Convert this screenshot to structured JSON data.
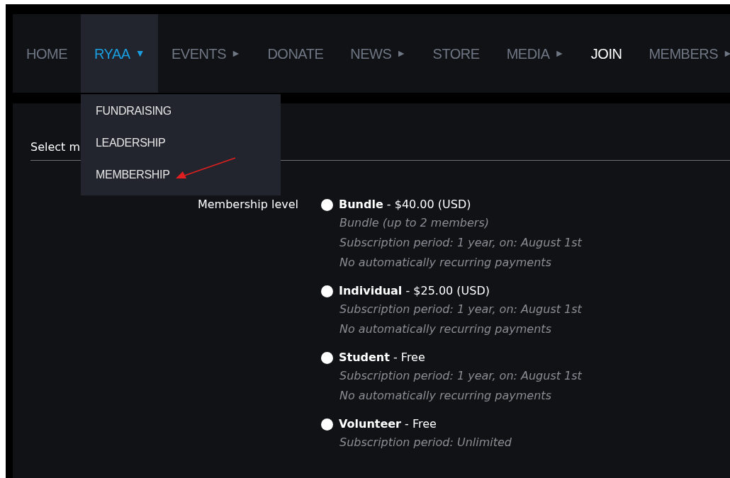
{
  "nav": [
    {
      "label": "HOME",
      "expanded": false,
      "selected": false
    },
    {
      "label": "RYAA",
      "caret": "▼",
      "expanded": true,
      "selected": false
    },
    {
      "label": "EVENTS",
      "caret": "►",
      "expanded": false,
      "selected": false
    },
    {
      "label": "DONATE",
      "expanded": false,
      "selected": false
    },
    {
      "label": "NEWS",
      "caret": "►",
      "expanded": false,
      "selected": false
    },
    {
      "label": "STORE",
      "expanded": false,
      "selected": false
    },
    {
      "label": "MEDIA",
      "caret": "►",
      "expanded": false,
      "selected": false
    },
    {
      "label": "JOIN",
      "expanded": false,
      "selected": true
    },
    {
      "label": "MEMBERS",
      "caret": "►",
      "expanded": false,
      "selected": false
    }
  ],
  "dropdown": {
    "items": [
      "FUNDRAISING",
      "LEADERSHIP",
      "MEMBERSHIP"
    ]
  },
  "form": {
    "heading": "Select m",
    "field_label": "Membership level",
    "options": [
      {
        "title": "**Bundle** - $40.00 (USD)",
        "selected": false,
        "details": [
          "Bundle (up to 2 members)",
          "Subscription period: 1 year, on: August 1st",
          "No automatically recurring payments"
        ]
      },
      {
        "title": "**Individual** - $25.00 (USD)",
        "selected": false,
        "details": [
          "Subscription period: 1 year, on: August 1st",
          "No automatically recurring payments"
        ]
      },
      {
        "title": "**Student** - Free",
        "selected": false,
        "details": [
          "Subscription period: 1 year, on: August 1st",
          "No automatically recurring payments"
        ]
      },
      {
        "title": "**Volunteer** - Free",
        "selected": false,
        "details": [
          "Subscription period: Unlimited"
        ]
      }
    ]
  }
}
